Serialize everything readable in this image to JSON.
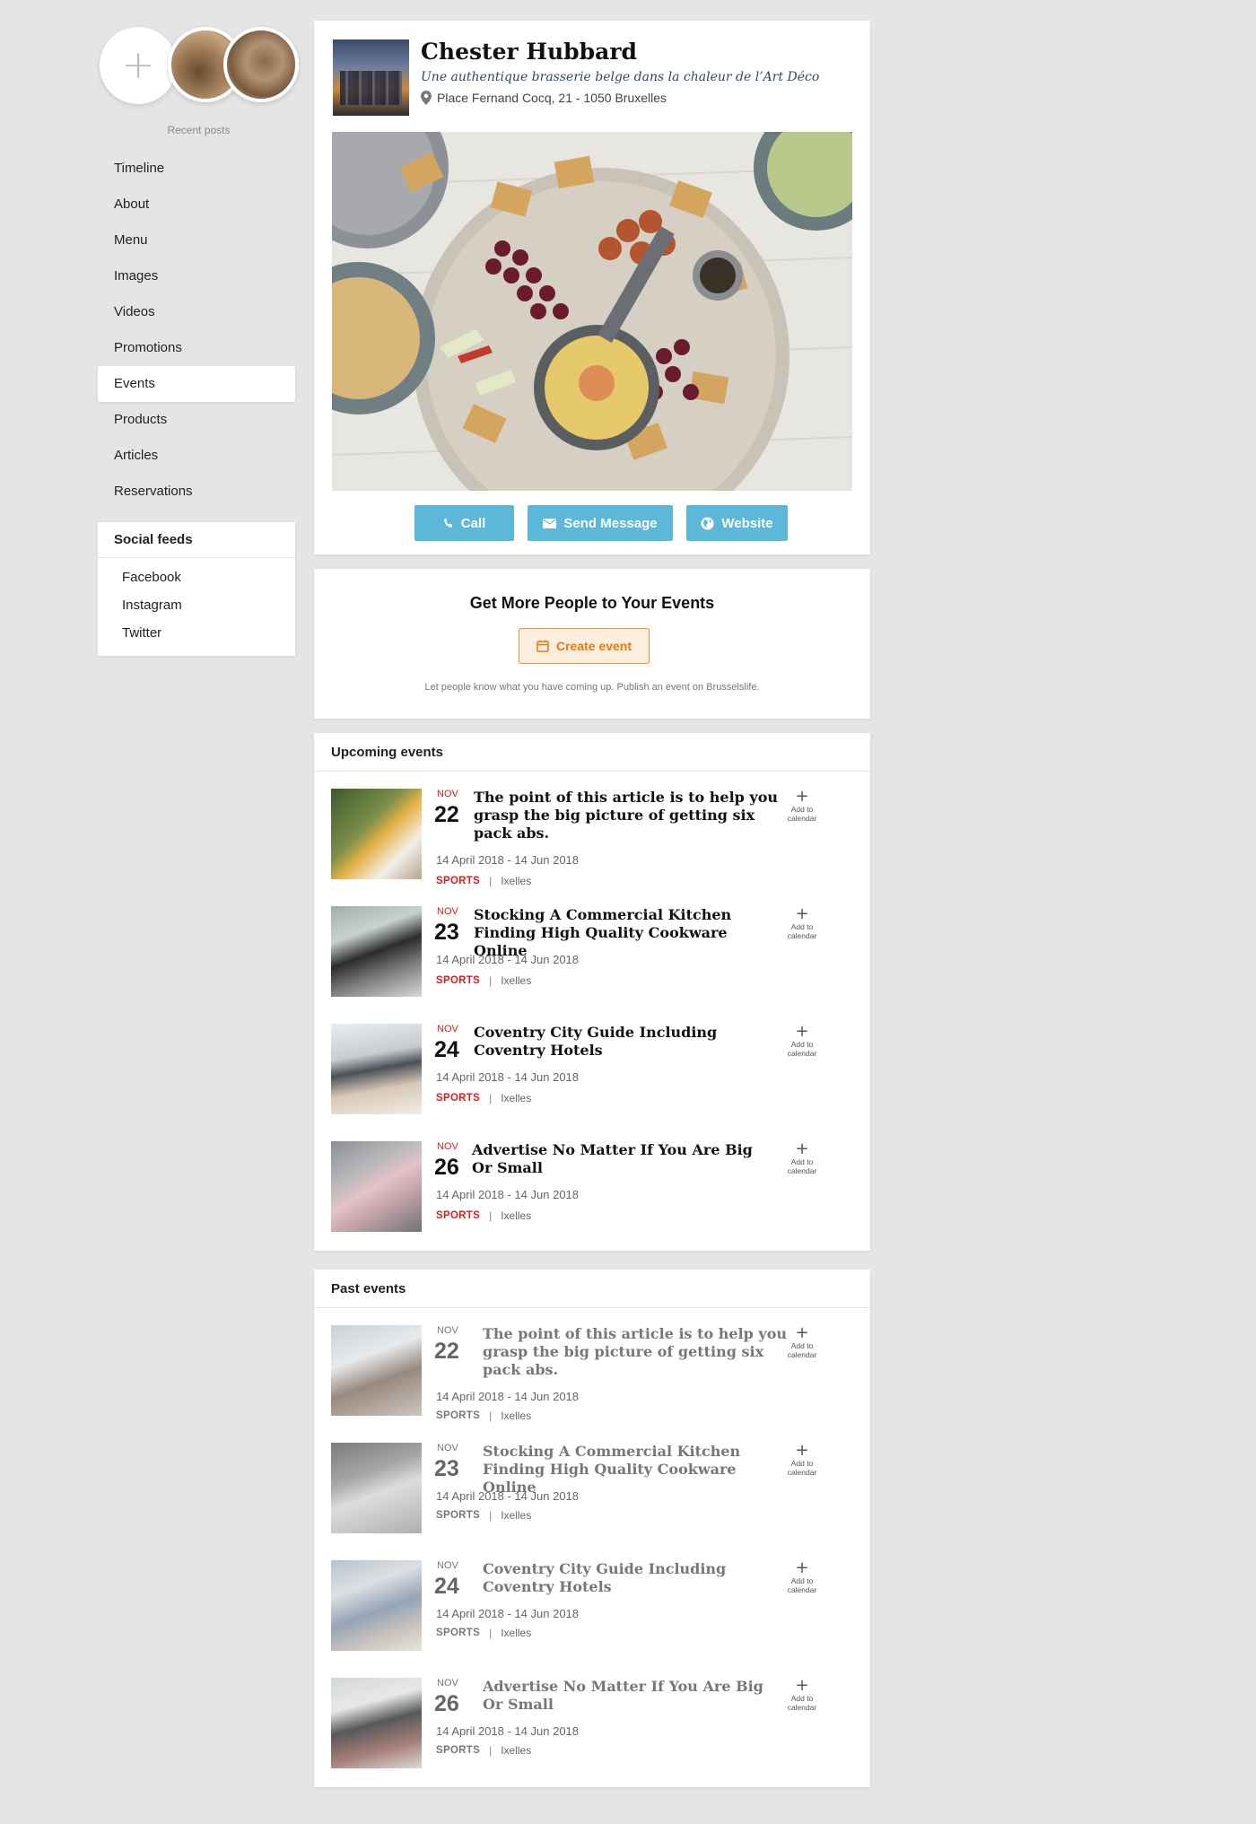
{
  "sidebar": {
    "recent_label": "Recent posts",
    "nav": [
      "Timeline",
      "About",
      "Menu",
      "Images",
      "Videos",
      "Promotions",
      "Events",
      "Products",
      "Articles",
      "Reservations"
    ],
    "active": "Events",
    "social_title": "Social feeds",
    "social": [
      "Facebook",
      "Instagram",
      "Twitter"
    ]
  },
  "profile": {
    "name": "Chester Hubbard",
    "tagline": "Une authentique brasserie belge dans la chaleur de l’Art Déco",
    "address": "Place Fernand Cocq, 21 - 1050 Bruxelles",
    "buttons": {
      "call": "Call",
      "message": "Send Message",
      "website": "Website"
    }
  },
  "promo": {
    "title": "Get More People to Your Events",
    "button": "Create event",
    "note": "Let people know what you have coming up. Publish an event on Brusselslife."
  },
  "upcoming": {
    "title": "Upcoming events",
    "items": [
      {
        "month": "NOV",
        "day": "22",
        "title": "The point of this article is to help you grasp the big picture of getting six pack abs.",
        "dates": "14 April 2018 - 14 Jun 2018",
        "category": "SPORTS",
        "location": "Ixelles",
        "add": "Add to calendar"
      },
      {
        "month": "NOV",
        "day": "23",
        "title": "Stocking A Commercial Kitchen Finding High Quality Cookware Online",
        "dates": "14 April 2018 - 14 Jun 2018",
        "category": "SPORTS",
        "location": "Ixelles",
        "add": "Add to calendar"
      },
      {
        "month": "NOV",
        "day": "24",
        "title": "Coventry City Guide Including Coventry Hotels",
        "dates": "14 April 2018 - 14 Jun 2018",
        "category": "SPORTS",
        "location": "Ixelles",
        "add": "Add to calendar"
      },
      {
        "month": "NOV",
        "day": "26",
        "title": "Advertise No Matter If You Are Big Or Small",
        "dates": "14 April 2018 - 14 Jun 2018",
        "category": "SPORTS",
        "location": "Ixelles",
        "add": "Add to calendar"
      }
    ]
  },
  "past": {
    "title": "Past events",
    "items": [
      {
        "month": "NOV",
        "day": "22",
        "title": "The point of this article is to help you grasp the big picture of getting six pack abs.",
        "dates": "14 April 2018 - 14 Jun 2018",
        "category": "SPORTS",
        "location": "Ixelles",
        "add": "Add to calendar"
      },
      {
        "month": "NOV",
        "day": "23",
        "title": "Stocking A Commercial Kitchen Finding High Quality Cookware Online",
        "dates": "14 April 2018 - 14 Jun 2018",
        "category": "SPORTS",
        "location": "Ixelles",
        "add": "Add to calendar"
      },
      {
        "month": "NOV",
        "day": "24",
        "title": "Coventry City Guide Including Coventry Hotels",
        "dates": "14 April 2018 - 14 Jun 2018",
        "category": "SPORTS",
        "location": "Ixelles",
        "add": "Add to calendar"
      },
      {
        "month": "NOV",
        "day": "26",
        "title": "Advertise No Matter If You Are Big Or Small",
        "dates": "14 April 2018 - 14 Jun 2018",
        "category": "SPORTS",
        "location": "Ixelles",
        "add": "Add to calendar"
      }
    ]
  },
  "colors": {
    "accent_blue": "#5bb8d8",
    "category_red": "#d42020",
    "create_orange": "#e77b12"
  }
}
